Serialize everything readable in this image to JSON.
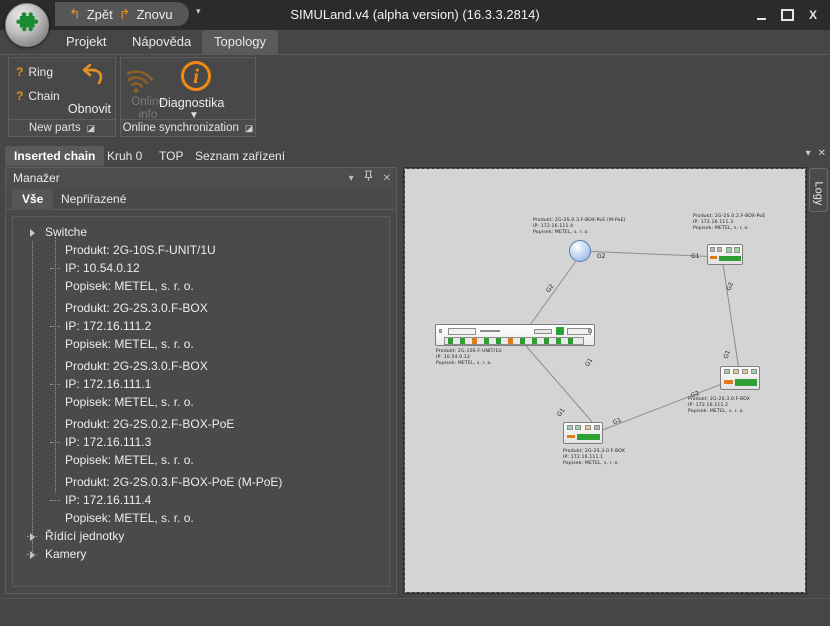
{
  "window": {
    "title": "SIMULand.v4 (alpha version) (16.3.3.2814)",
    "minimize_label": "minimize",
    "maximize_label": "maximize",
    "close_label": "X"
  },
  "quick_access": {
    "undo_label": "Zpět",
    "redo_label": "Znovu",
    "undo_icon": "↰",
    "redo_icon": "↱",
    "dropdown_icon": "▾"
  },
  "logo": {
    "icon": "puzzle-piece",
    "glyph": "✖"
  },
  "ribbon": {
    "tabs": [
      {
        "label": "Projekt",
        "active": false
      },
      {
        "label": "Nápověda",
        "active": false
      },
      {
        "label": "Topology",
        "active": true
      }
    ],
    "groups": [
      {
        "title": "New parts",
        "dialog_launcher": "⌐",
        "checkboxes": [
          {
            "marker": "?",
            "label": "Ring"
          },
          {
            "marker": "?",
            "label": "Chain"
          }
        ],
        "refresh_label": "Obnovit",
        "refresh_icon": "undo-arrow"
      },
      {
        "title": "Online synchronization",
        "dialog_launcher": "⌐",
        "online_info_label_line1": "Online",
        "online_info_label_line2": "info",
        "online_info_icon": "wifi-icon",
        "diagnostics_label": "Diagnostika",
        "diagnostics_icon": "info-circle-icon",
        "diagnostics_caret": "▼"
      }
    ]
  },
  "document_tabs": {
    "items": [
      {
        "label": "Inserted chain",
        "active": true
      },
      {
        "label": "Kruh 0",
        "active": false
      },
      {
        "label": "TOP",
        "active": false
      },
      {
        "label": "Seznam zařízení",
        "active": false
      }
    ],
    "dropdown_icon": "▾",
    "close_icon": "✕"
  },
  "manager": {
    "title": "Manažer",
    "header_controls": {
      "dropdown_icon": "▾",
      "pin_icon": "⇩",
      "close_icon": "✕"
    },
    "tabs": [
      {
        "label": "Vše",
        "active": true
      },
      {
        "label": "Nepřiřazené",
        "active": false
      }
    ],
    "tree": [
      {
        "type": "root",
        "label": "Switche"
      },
      {
        "type": "leaf",
        "label": "Produkt: 2G-10S.F-UNIT/1U"
      },
      {
        "type": "leaf",
        "label": "IP: 10.54.0.12",
        "dash": true
      },
      {
        "type": "leaf",
        "label": "Popisek: METEL, s. r. o."
      },
      {
        "type": "gap"
      },
      {
        "type": "leaf",
        "label": "Produkt: 2G-2S.3.0.F-BOX"
      },
      {
        "type": "leaf",
        "label": "IP: 172.16.111.2",
        "dash": true
      },
      {
        "type": "leaf",
        "label": "Popisek: METEL, s. r. o."
      },
      {
        "type": "gap"
      },
      {
        "type": "leaf",
        "label": "Produkt: 2G-2S.3.0.F-BOX"
      },
      {
        "type": "leaf",
        "label": "IP: 172.16.111.1",
        "dash": true
      },
      {
        "type": "leaf",
        "label": "Popisek: METEL, s. r. o."
      },
      {
        "type": "gap"
      },
      {
        "type": "leaf",
        "label": "Produkt: 2G-2S.0.2.F-BOX-PoE"
      },
      {
        "type": "leaf",
        "label": "IP: 172.16.111.3",
        "dash": true
      },
      {
        "type": "leaf",
        "label": "Popisek: METEL, s. r. o."
      },
      {
        "type": "gap"
      },
      {
        "type": "leaf",
        "label": "Produkt: 2G-2S.0.3.F-BOX-PoE (M-PoE)"
      },
      {
        "type": "leaf",
        "label": "IP: 172.16.111.4",
        "dash": true
      },
      {
        "type": "leaf",
        "label": "Popisek: METEL, s. r. o."
      },
      {
        "type": "root2",
        "label": "Řídící jednotky"
      },
      {
        "type": "root2",
        "label": "Kamery"
      }
    ]
  },
  "side_panel": {
    "logs_tab_label": "Logy"
  },
  "topology": {
    "nodes": [
      {
        "id": "n-mpoe",
        "kind": "circle",
        "label_lines": [
          "Produkt: 2G-2S.0.3.F-BOX-PoE (M-PoE)",
          "IP: 172.16.111.4",
          "Popisek: METEL, s. r. o."
        ]
      },
      {
        "id": "n-poe",
        "kind": "switch",
        "label_lines": [
          "Produkt: 2G-2S.0.2.F-BOX-PoE",
          "IP: 172.16.111.3",
          "Popisek: METEL, s. r. o."
        ]
      },
      {
        "id": "n-unit",
        "kind": "rack",
        "label_lines": [
          "Produkt: 2G-10S.F-UNIT/1U",
          "IP: 10.54.0.12",
          "Popisek: METEL, s. r. o."
        ]
      },
      {
        "id": "n-box1",
        "kind": "switch",
        "label_lines": [
          "Produkt: 2G-2S.3.0.F-BOX",
          "IP: 172.16.111.1",
          "Popisek: METEL, s. r. o."
        ]
      },
      {
        "id": "n-box2",
        "kind": "switch",
        "label_lines": [
          "Produkt: 2G-2S.3.0.F-BOX",
          "IP: 172.16.111.2",
          "Popisek: METEL, s. r. o."
        ]
      }
    ],
    "port_labels": [
      "G2",
      "G1",
      "G2",
      "G1",
      "G2",
      "G1",
      "G1",
      "G2"
    ]
  }
}
